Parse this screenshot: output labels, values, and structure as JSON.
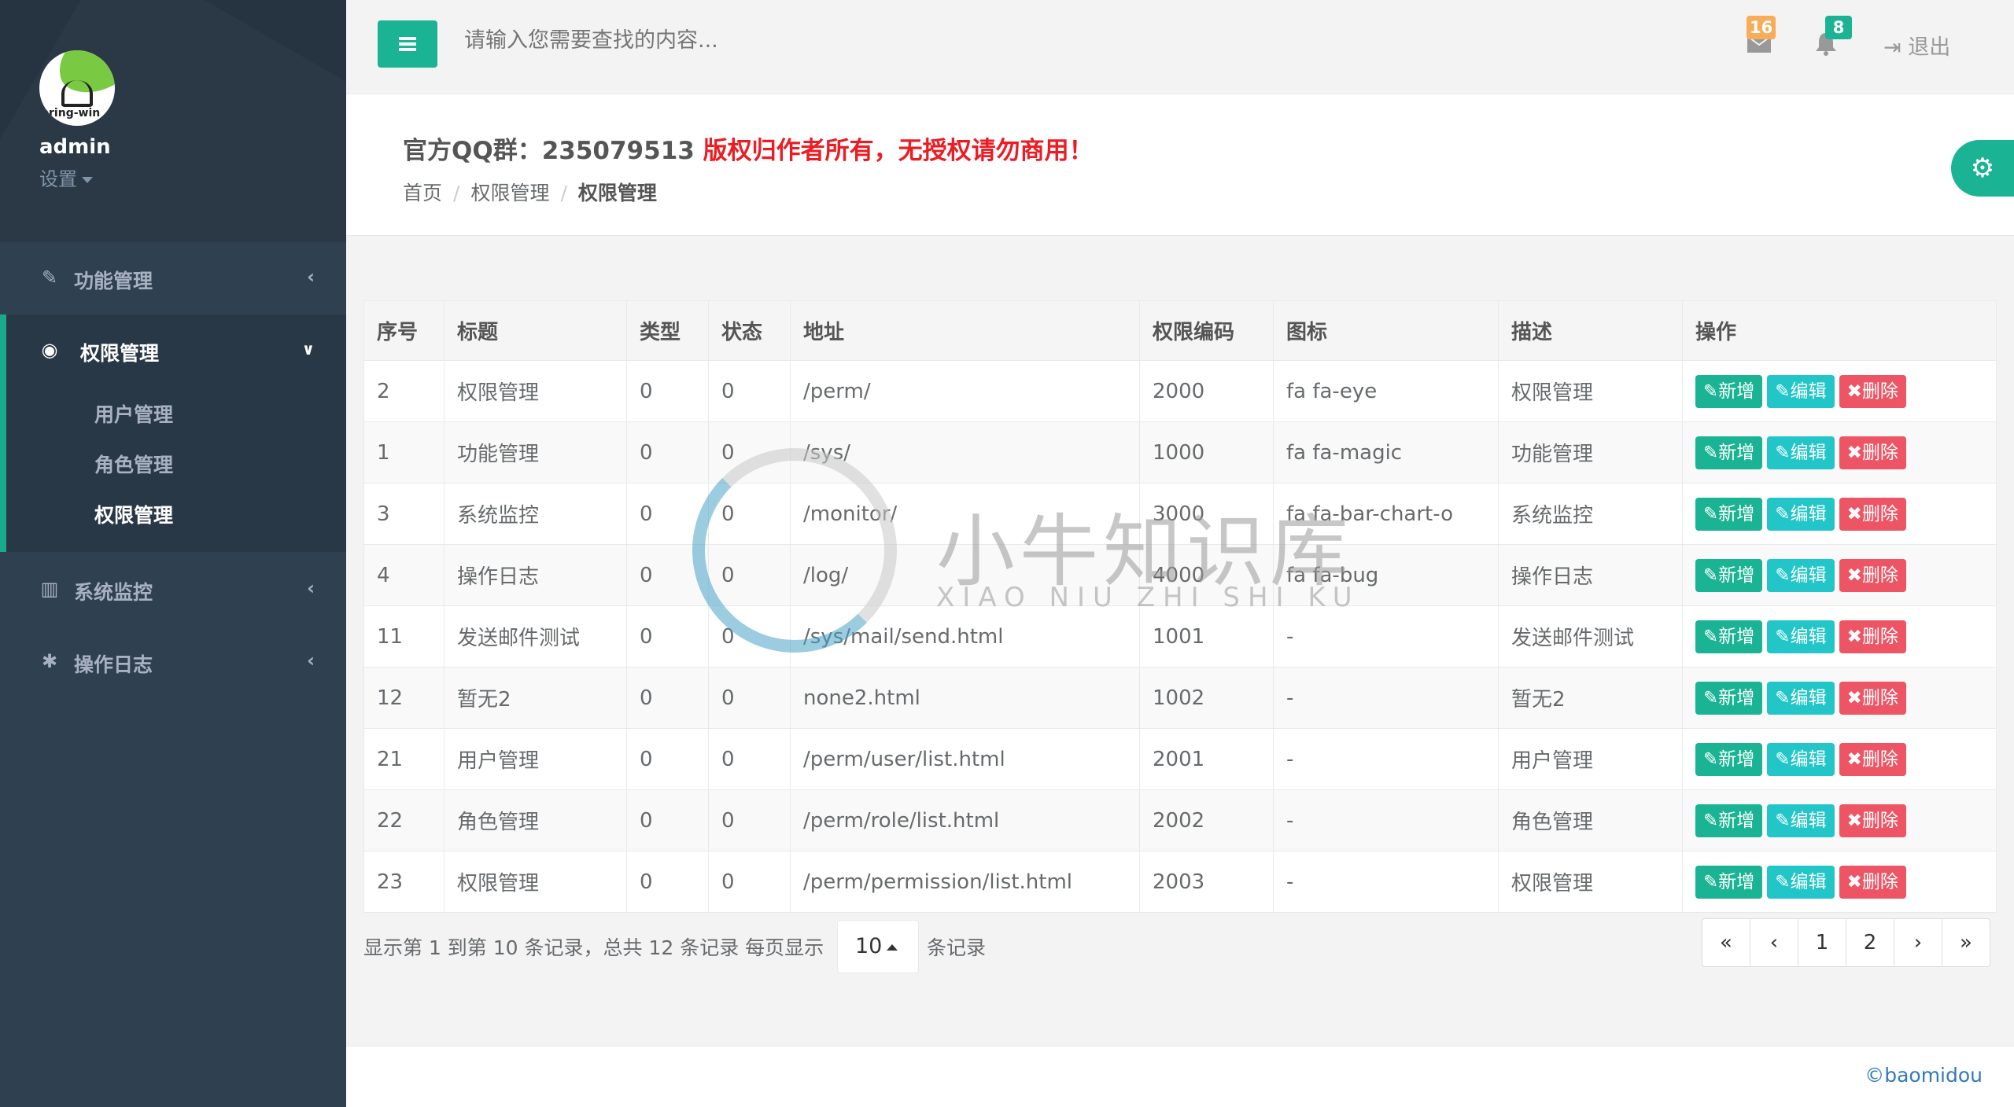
{
  "sidebar": {
    "avatar_text": "pring-win",
    "username": "admin",
    "settings_label": "设置",
    "menu": [
      {
        "label": "功能管理",
        "icon": "magic-wand-icon"
      },
      {
        "label": "权限管理",
        "icon": "eye-icon",
        "submenu": [
          "用户管理",
          "角色管理",
          "权限管理"
        ],
        "current": "权限管理"
      },
      {
        "label": "系统监控",
        "icon": "bar-chart-icon"
      },
      {
        "label": "操作日志",
        "icon": "bug-icon"
      }
    ]
  },
  "topbar": {
    "search_placeholder": "请输入您需要查找的内容...",
    "mail_count": "16",
    "alert_count": "8",
    "logout_label": "退出"
  },
  "header": {
    "qq_group": "官方QQ群：235079513 ",
    "warning": "版权归作者所有，无授权请勿商用！",
    "breadcrumb": [
      "首页",
      "权限管理",
      "权限管理"
    ]
  },
  "table": {
    "headers": [
      "序号",
      "标题",
      "类型",
      "状态",
      "地址",
      "权限编码",
      "图标",
      "描述",
      "操作"
    ],
    "rows": [
      [
        "2",
        "权限管理",
        "0",
        "0",
        "/perm/",
        "2000",
        "fa fa-eye",
        "权限管理"
      ],
      [
        "1",
        "功能管理",
        "0",
        "0",
        "/sys/",
        "1000",
        "fa fa-magic",
        "功能管理"
      ],
      [
        "3",
        "系统监控",
        "0",
        "0",
        "/monitor/",
        "3000",
        "fa fa-bar-chart-o",
        "系统监控"
      ],
      [
        "4",
        "操作日志",
        "0",
        "0",
        "/log/",
        "4000",
        "fa fa-bug",
        "操作日志"
      ],
      [
        "11",
        "发送邮件测试",
        "0",
        "0",
        "/sys/mail/send.html",
        "1001",
        "-",
        "发送邮件测试"
      ],
      [
        "12",
        "暂无2",
        "0",
        "0",
        "none2.html",
        "1002",
        "-",
        "暂无2"
      ],
      [
        "21",
        "用户管理",
        "0",
        "0",
        "/perm/user/list.html",
        "2001",
        "-",
        "用户管理"
      ],
      [
        "22",
        "角色管理",
        "0",
        "0",
        "/perm/role/list.html",
        "2002",
        "-",
        "角色管理"
      ],
      [
        "23",
        "权限管理",
        "0",
        "0",
        "/perm/permission/list.html",
        "2003",
        "-",
        "权限管理"
      ]
    ],
    "actions": {
      "add": "新增",
      "edit": "编辑",
      "delete": "删除"
    }
  },
  "pager": {
    "info": "显示第 1 到第 10 条记录，总共 12 条记录 每页显示",
    "page_size": "10",
    "suffix": "条记录",
    "pages": [
      "«",
      "‹",
      "1",
      "2",
      "›",
      "»"
    ]
  },
  "footer": {
    "copyright": "©baomidou"
  },
  "watermark": {
    "cn": "小牛知识库",
    "en": "XIAO NIU ZHI SHI KU"
  },
  "colors": {
    "sidebar": "#2f4050",
    "accent": "#1ab394",
    "info": "#23c6c8",
    "danger": "#ed5565",
    "warning_text": "#ed1c24",
    "badge_mail": "#f8ac59"
  }
}
